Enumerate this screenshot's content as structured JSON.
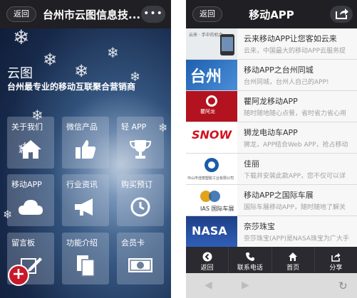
{
  "left": {
    "back_label": "返回",
    "title": "台州市云图信息技...",
    "more_label": "•••",
    "brand": "云图",
    "slogan": "台州最专业的移动互联聚合营销商",
    "tiles": [
      {
        "label": "关于我们",
        "icon": "house-icon"
      },
      {
        "label": "微信产品",
        "icon": "thumbs-up-icon"
      },
      {
        "label": "轻 APP",
        "icon": "trophy-icon"
      },
      {
        "label": "移动APP",
        "icon": "cloud-icon"
      },
      {
        "label": "行业资讯",
        "icon": "megaphone-icon"
      },
      {
        "label": "购买预订",
        "icon": "clock-icon"
      },
      {
        "label": "留言板",
        "icon": "pencil-icon"
      },
      {
        "label": "功能介绍",
        "icon": "documents-icon"
      },
      {
        "label": "会员卡",
        "icon": "money-card-icon"
      }
    ],
    "add_label": "+"
  },
  "right": {
    "back_label": "返回",
    "title": "移动APP",
    "items": [
      {
        "title": "云来移动APP让您客如云来",
        "subtitle": "云来，中国最大的移动APP云服务提",
        "thumb_text": "云来 · 手中的机会"
      },
      {
        "title": "移动APP之台州同城",
        "subtitle": "台州同城，台州人自己的APP!",
        "thumb_text": "台州"
      },
      {
        "title": "瞿阿龙移动APP",
        "subtitle": "随时随地随心点餐，省时省力省心用",
        "thumb_text": "瞿阿龙"
      },
      {
        "title": "狮龙电动车APP",
        "subtitle": "狮龙，APP结合Web APP，抢占移动",
        "thumb_text": "SNOW"
      },
      {
        "title": "佳丽",
        "subtitle": "下载并安装此款APP，您不仅可以详",
        "thumb_text": "中山市佳丽塑胶工业有限公司"
      },
      {
        "title": "移动APP之国际车展",
        "subtitle": "国际车展移动APP，随时随地了解关",
        "thumb_text": "IAS 国际车展"
      },
      {
        "title": "奈莎珠宝",
        "subtitle": "奈莎珠宝(APP)是NASA珠宝为广大手",
        "thumb_text": "NASA"
      }
    ],
    "tabs": [
      {
        "label": "返回",
        "icon": "back-arrow-icon"
      },
      {
        "label": "联系电话",
        "icon": "phone-icon"
      },
      {
        "label": "首页",
        "icon": "home-icon"
      },
      {
        "label": "分享",
        "icon": "share-icon"
      }
    ],
    "browser": {
      "back": "◀",
      "forward": "▶",
      "refresh": "↻"
    }
  },
  "colors": {
    "topbar": "#1f1f24",
    "tabbar": "#2a2a30",
    "accent_red": "#c8192a"
  }
}
